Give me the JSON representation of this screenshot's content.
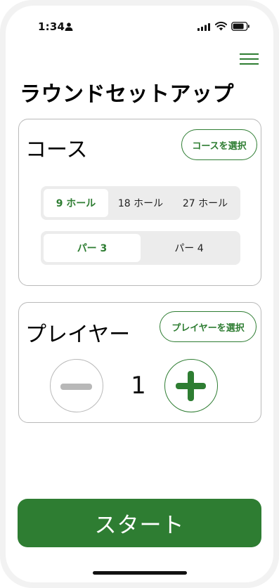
{
  "status_bar": {
    "time": "1:34"
  },
  "header": {
    "title": "ラウンドセットアップ"
  },
  "course": {
    "title": "コース",
    "select_label": "コースを選択",
    "holes_options": [
      "9 ホール",
      "18 ホール",
      "27 ホール"
    ],
    "holes_selected": "9 ホール",
    "par_options": [
      "パー 3",
      "パー 4"
    ],
    "par_selected": "パー 3"
  },
  "player": {
    "title": "プレイヤー",
    "select_label": "プレイヤーを選択",
    "count": "1"
  },
  "footer": {
    "start_label": "スタート"
  },
  "colors": {
    "accent": "#2e7d32",
    "border": "#b9b9b9",
    "segment_bg": "#ececec",
    "minus_disabled": "#b8b8b8"
  },
  "icons": [
    "person-icon",
    "signal-icon",
    "wifi-icon",
    "battery-icon",
    "menu-icon",
    "minus-icon",
    "plus-icon"
  ]
}
